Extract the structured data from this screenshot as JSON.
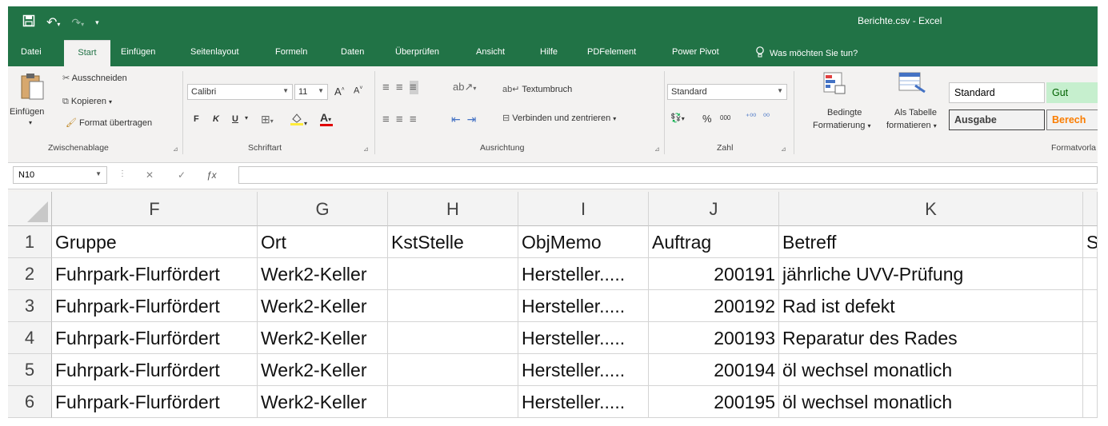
{
  "window": {
    "title": "Berichte.csv  -  Excel"
  },
  "tabs": [
    "Datei",
    "Start",
    "Einfügen",
    "Seitenlayout",
    "Formeln",
    "Daten",
    "Überprüfen",
    "Ansicht",
    "Hilfe",
    "PDFelement",
    "Power Pivot"
  ],
  "active_tab": "Start",
  "tell_me": "Was möchten Sie tun?",
  "ribbon": {
    "clipboard": {
      "paste": "Einfügen",
      "cut": "Ausschneiden",
      "copy": "Kopieren",
      "format_painter": "Format übertragen",
      "label": "Zwischenablage"
    },
    "font": {
      "name": "Calibri",
      "size": "11",
      "bold": "F",
      "italic": "K",
      "underline": "U",
      "label": "Schriftart"
    },
    "alignment": {
      "wrap": "Textumbruch",
      "merge": "Verbinden und zentrieren",
      "label": "Ausrichtung"
    },
    "number": {
      "format": "Standard",
      "percent": "%",
      "thousands": "000",
      "label": "Zahl"
    },
    "styles": {
      "conditional_1": "Bedingte",
      "conditional_2": "Formatierung",
      "table_1": "Als Tabelle",
      "table_2": "formatieren",
      "standard": "Standard",
      "gut": "Gut",
      "ausgabe": "Ausgabe",
      "berech": "Berech",
      "label": "Formatvorla"
    }
  },
  "formula_bar": {
    "name_box": "N10",
    "formula": ""
  },
  "columns": [
    "F",
    "G",
    "H",
    "I",
    "J",
    "K",
    ""
  ],
  "rows": [
    {
      "num": "1",
      "cells": [
        "Gruppe",
        "Ort",
        "KstStelle",
        "ObjMemo",
        "Auftrag",
        "Betreff",
        "S"
      ]
    },
    {
      "num": "2",
      "cells": [
        "Fuhrpark-Flurfördert",
        "Werk2-Keller",
        "",
        "Hersteller.....",
        "200191",
        "jährliche UVV-Prüfung",
        ""
      ]
    },
    {
      "num": "3",
      "cells": [
        "Fuhrpark-Flurfördert",
        "Werk2-Keller",
        "",
        "Hersteller.....",
        "200192",
        "Rad ist defekt",
        ""
      ]
    },
    {
      "num": "4",
      "cells": [
        "Fuhrpark-Flurfördert",
        "Werk2-Keller",
        "",
        "Hersteller.....",
        "200193",
        "Reparatur des Rades",
        ""
      ]
    },
    {
      "num": "5",
      "cells": [
        "Fuhrpark-Flurfördert",
        "Werk2-Keller",
        "",
        "Hersteller.....",
        "200194",
        "öl wechsel monatlich",
        ""
      ]
    },
    {
      "num": "6",
      "cells": [
        "Fuhrpark-Flurfördert",
        "Werk2-Keller",
        "",
        "Hersteller.....",
        "200195",
        "öl wechsel monatlich",
        ""
      ]
    }
  ],
  "colors": {
    "excel_green": "#217346"
  }
}
